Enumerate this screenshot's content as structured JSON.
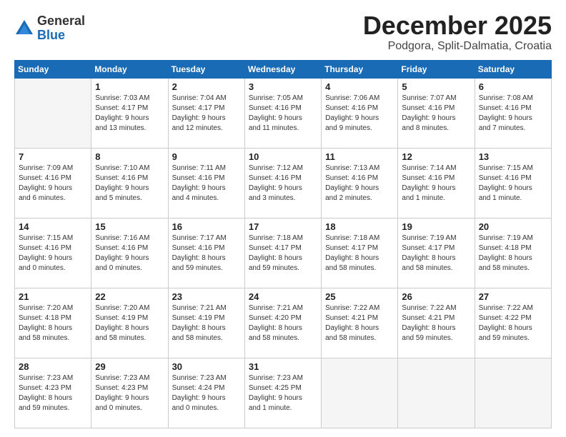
{
  "logo": {
    "general": "General",
    "blue": "Blue"
  },
  "header": {
    "title": "December 2025",
    "location": "Podgora, Split-Dalmatia, Croatia"
  },
  "weekdays": [
    "Sunday",
    "Monday",
    "Tuesday",
    "Wednesday",
    "Thursday",
    "Friday",
    "Saturday"
  ],
  "weeks": [
    [
      {
        "day": "",
        "text": ""
      },
      {
        "day": "1",
        "text": "Sunrise: 7:03 AM\nSunset: 4:17 PM\nDaylight: 9 hours\nand 13 minutes."
      },
      {
        "day": "2",
        "text": "Sunrise: 7:04 AM\nSunset: 4:17 PM\nDaylight: 9 hours\nand 12 minutes."
      },
      {
        "day": "3",
        "text": "Sunrise: 7:05 AM\nSunset: 4:16 PM\nDaylight: 9 hours\nand 11 minutes."
      },
      {
        "day": "4",
        "text": "Sunrise: 7:06 AM\nSunset: 4:16 PM\nDaylight: 9 hours\nand 9 minutes."
      },
      {
        "day": "5",
        "text": "Sunrise: 7:07 AM\nSunset: 4:16 PM\nDaylight: 9 hours\nand 8 minutes."
      },
      {
        "day": "6",
        "text": "Sunrise: 7:08 AM\nSunset: 4:16 PM\nDaylight: 9 hours\nand 7 minutes."
      }
    ],
    [
      {
        "day": "7",
        "text": "Sunrise: 7:09 AM\nSunset: 4:16 PM\nDaylight: 9 hours\nand 6 minutes."
      },
      {
        "day": "8",
        "text": "Sunrise: 7:10 AM\nSunset: 4:16 PM\nDaylight: 9 hours\nand 5 minutes."
      },
      {
        "day": "9",
        "text": "Sunrise: 7:11 AM\nSunset: 4:16 PM\nDaylight: 9 hours\nand 4 minutes."
      },
      {
        "day": "10",
        "text": "Sunrise: 7:12 AM\nSunset: 4:16 PM\nDaylight: 9 hours\nand 3 minutes."
      },
      {
        "day": "11",
        "text": "Sunrise: 7:13 AM\nSunset: 4:16 PM\nDaylight: 9 hours\nand 2 minutes."
      },
      {
        "day": "12",
        "text": "Sunrise: 7:14 AM\nSunset: 4:16 PM\nDaylight: 9 hours\nand 1 minute."
      },
      {
        "day": "13",
        "text": "Sunrise: 7:15 AM\nSunset: 4:16 PM\nDaylight: 9 hours\nand 1 minute."
      }
    ],
    [
      {
        "day": "14",
        "text": "Sunrise: 7:15 AM\nSunset: 4:16 PM\nDaylight: 9 hours\nand 0 minutes."
      },
      {
        "day": "15",
        "text": "Sunrise: 7:16 AM\nSunset: 4:16 PM\nDaylight: 9 hours\nand 0 minutes."
      },
      {
        "day": "16",
        "text": "Sunrise: 7:17 AM\nSunset: 4:16 PM\nDaylight: 8 hours\nand 59 minutes."
      },
      {
        "day": "17",
        "text": "Sunrise: 7:18 AM\nSunset: 4:17 PM\nDaylight: 8 hours\nand 59 minutes."
      },
      {
        "day": "18",
        "text": "Sunrise: 7:18 AM\nSunset: 4:17 PM\nDaylight: 8 hours\nand 58 minutes."
      },
      {
        "day": "19",
        "text": "Sunrise: 7:19 AM\nSunset: 4:17 PM\nDaylight: 8 hours\nand 58 minutes."
      },
      {
        "day": "20",
        "text": "Sunrise: 7:19 AM\nSunset: 4:18 PM\nDaylight: 8 hours\nand 58 minutes."
      }
    ],
    [
      {
        "day": "21",
        "text": "Sunrise: 7:20 AM\nSunset: 4:18 PM\nDaylight: 8 hours\nand 58 minutes."
      },
      {
        "day": "22",
        "text": "Sunrise: 7:20 AM\nSunset: 4:19 PM\nDaylight: 8 hours\nand 58 minutes."
      },
      {
        "day": "23",
        "text": "Sunrise: 7:21 AM\nSunset: 4:19 PM\nDaylight: 8 hours\nand 58 minutes."
      },
      {
        "day": "24",
        "text": "Sunrise: 7:21 AM\nSunset: 4:20 PM\nDaylight: 8 hours\nand 58 minutes."
      },
      {
        "day": "25",
        "text": "Sunrise: 7:22 AM\nSunset: 4:21 PM\nDaylight: 8 hours\nand 58 minutes."
      },
      {
        "day": "26",
        "text": "Sunrise: 7:22 AM\nSunset: 4:21 PM\nDaylight: 8 hours\nand 59 minutes."
      },
      {
        "day": "27",
        "text": "Sunrise: 7:22 AM\nSunset: 4:22 PM\nDaylight: 8 hours\nand 59 minutes."
      }
    ],
    [
      {
        "day": "28",
        "text": "Sunrise: 7:23 AM\nSunset: 4:23 PM\nDaylight: 8 hours\nand 59 minutes."
      },
      {
        "day": "29",
        "text": "Sunrise: 7:23 AM\nSunset: 4:23 PM\nDaylight: 9 hours\nand 0 minutes."
      },
      {
        "day": "30",
        "text": "Sunrise: 7:23 AM\nSunset: 4:24 PM\nDaylight: 9 hours\nand 0 minutes."
      },
      {
        "day": "31",
        "text": "Sunrise: 7:23 AM\nSunset: 4:25 PM\nDaylight: 9 hours\nand 1 minute."
      },
      {
        "day": "",
        "text": ""
      },
      {
        "day": "",
        "text": ""
      },
      {
        "day": "",
        "text": ""
      }
    ]
  ]
}
